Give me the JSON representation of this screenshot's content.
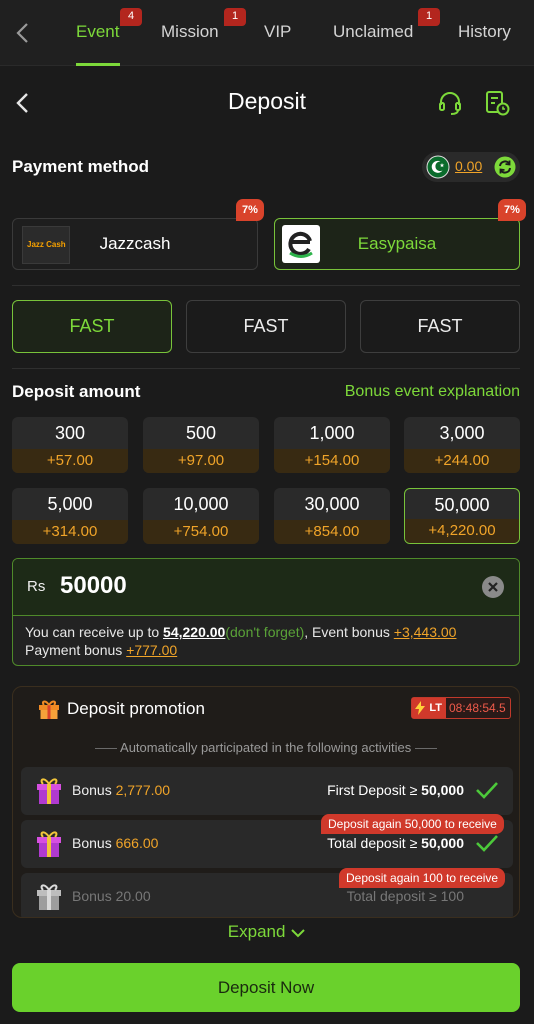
{
  "tabs": [
    {
      "label": "Event",
      "badge": "4",
      "active": true
    },
    {
      "label": "Mission",
      "badge": "1"
    },
    {
      "label": "VIP",
      "badge": ""
    },
    {
      "label": "Unclaimed",
      "badge": "1"
    },
    {
      "label": "History",
      "badge": ""
    }
  ],
  "header": {
    "title": "Deposit"
  },
  "payment": {
    "label": "Payment method",
    "balance": "0.00",
    "methods": [
      {
        "name": "Jazzcash",
        "badge": "7%",
        "logo_text": "Jazz Cash",
        "selected": false
      },
      {
        "name": "Easypaisa",
        "badge": "7%",
        "selected": true
      }
    ],
    "channels": [
      {
        "label": "FAST",
        "selected": true
      },
      {
        "label": "FAST",
        "selected": false
      },
      {
        "label": "FAST",
        "selected": false
      }
    ]
  },
  "amount": {
    "label": "Deposit amount",
    "explain_link": "Bonus event explanation",
    "options": [
      {
        "value": "300",
        "bonus": "+57.00"
      },
      {
        "value": "500",
        "bonus": "+97.00"
      },
      {
        "value": "1,000",
        "bonus": "+154.00"
      },
      {
        "value": "3,000",
        "bonus": "+244.00"
      },
      {
        "value": "5,000",
        "bonus": "+314.00"
      },
      {
        "value": "10,000",
        "bonus": "+754.00"
      },
      {
        "value": "30,000",
        "bonus": "+854.00"
      },
      {
        "value": "50,000",
        "bonus": "+4,220.00",
        "selected": true
      }
    ],
    "currency": "Rs",
    "input_value": "50000",
    "receive_prefix": "You can receive up to",
    "receive_amount": "54,220.00",
    "receive_note": "(don't forget)",
    "event_bonus_label": ", Event bonus",
    "event_bonus": "+3,443.00",
    "payment_bonus_label": "Payment bonus",
    "payment_bonus": "+777.00"
  },
  "promotion": {
    "title": "Deposit promotion",
    "timer_badge": "LT",
    "timer": "08:48:54.5",
    "subtitle": "Automatically participated in the following activities",
    "activities": [
      {
        "bonus_label": "Bonus",
        "bonus": "2,777.00",
        "cond_label": "First Deposit ≥",
        "cond_value": "50,000",
        "done": true,
        "tip": ""
      },
      {
        "bonus_label": "Bonus",
        "bonus": "666.00",
        "cond_label": "Total deposit ≥",
        "cond_value": "50,000",
        "done": true,
        "tip": "Deposit again 50,000 to receive"
      },
      {
        "bonus_label": "Bonus",
        "bonus": "20.00",
        "cond_label": "Total deposit ≥",
        "cond_value": "100",
        "done": false,
        "tip": "Deposit again 100 to receive"
      }
    ],
    "expand_label": "Expand"
  },
  "cta": {
    "label": "Deposit Now"
  },
  "colors": {
    "accent": "#7dd93a",
    "bonus": "#f0a429",
    "badge": "#d9432b",
    "cta": "#6ad12c"
  }
}
